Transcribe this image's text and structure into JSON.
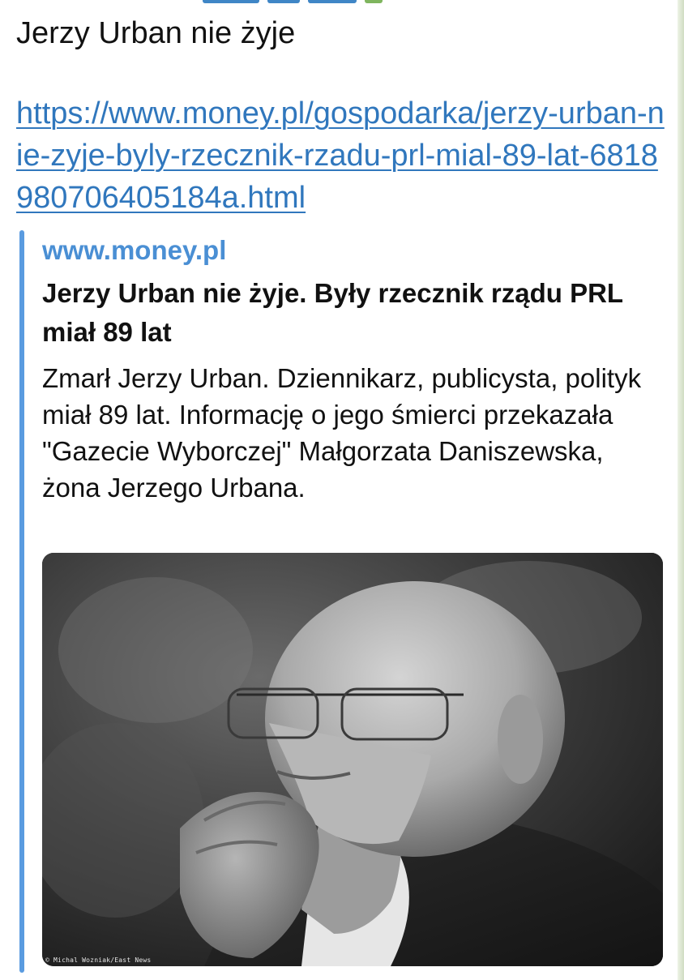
{
  "message": {
    "text": "Jerzy Urban nie żyje",
    "link": "https://www.money.pl/gospodarka/jerzy-urban-nie-zyje-byly-rzecznik-rzadu-prl-mial-89-lat-6818980706405184a.html"
  },
  "preview": {
    "site_name": "www.money.pl",
    "title": "Jerzy Urban nie żyje. Były rzecznik rządu PRL miał 89 lat",
    "description": "Zmarł Jerzy Urban. Dziennikarz, publicysta, polityk miał 89 lat. Informację o jego śmierci przekazała \"Gazecie Wyborczej\" Małgorzata Daniszewska, żona Jerzego Urbana.",
    "photo_credit": "© Michal Wozniak/East News"
  },
  "colors": {
    "link": "#3077bd",
    "site_name": "#4a8fd4",
    "preview_bar": "#5a9be0",
    "text": "#111111"
  }
}
